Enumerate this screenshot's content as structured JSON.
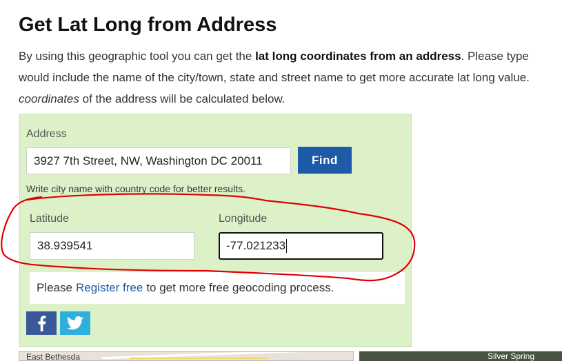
{
  "page": {
    "title": "Get Lat Long from Address",
    "intro": {
      "line1_pre": "By using this geographic tool you can get the ",
      "line1_bold": "lat long coordinates from an address",
      "line1_post": ". Please type",
      "line2": "would include the name of the city/town, state and street name to get more accurate lat long value.",
      "line3_italic": "coordinates",
      "line3_post": " of the address will be calculated below."
    }
  },
  "form": {
    "address_label": "Address",
    "address_value": "3927 7th Street, NW, Washington DC 20011",
    "find_label": "Find",
    "hint": "Write city name with country code for better results.",
    "latitude_label": "Latitude",
    "latitude_value": "38.939541",
    "longitude_label": "Longitude",
    "longitude_value": "-77.021233"
  },
  "notice": {
    "pre": "Please",
    "link": "Register free",
    "post": "to get more free geocoding process."
  },
  "share": {
    "facebook_icon": "facebook-icon",
    "twitter_icon": "twitter-icon",
    "facebook_color": "#3b5998",
    "twitter_color": "#2fb0dc"
  },
  "map": {
    "left_label": "East Bethesda",
    "right_label": "Silver Spring"
  },
  "annotation": {
    "color": "#e00000"
  }
}
